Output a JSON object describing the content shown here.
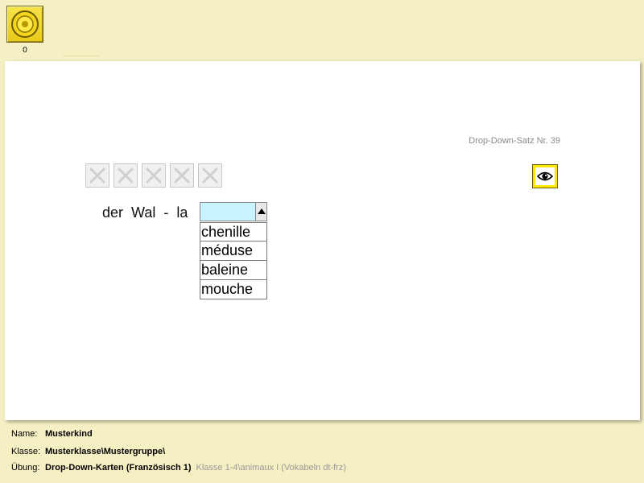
{
  "toolbar": {
    "coin_count": "0"
  },
  "panel": {
    "set_label": "Drop-Down-Satz Nr. 39",
    "attempt_boxes": [
      "empty",
      "empty",
      "empty",
      "empty",
      "empty"
    ],
    "sentence": "der  Wal  -  la",
    "dropdown": {
      "value": "",
      "options": [
        "chenille",
        "méduse",
        "baleine",
        "mouche"
      ]
    }
  },
  "footer": {
    "name_label": "Name:",
    "name_value": "Musterkind",
    "class_label": "Klasse:",
    "class_value": "Musterklasse\\Mustergruppe\\",
    "exercise_label": "Übung:",
    "exercise_value": "Drop-Down-Karten (Französisch 1)",
    "exercise_path": "Klasse 1-4\\animaux I (Vokabeln dt-frz)"
  },
  "colors": {
    "background": "#f5efc4",
    "accent_yellow": "#ffe800",
    "dropdown_field": "#c8f3ff"
  },
  "icons": {
    "coin": "coin-icon",
    "attempt": "x-icon",
    "reveal": "eye-icon",
    "dropdown": "triangle-up-icon"
  }
}
